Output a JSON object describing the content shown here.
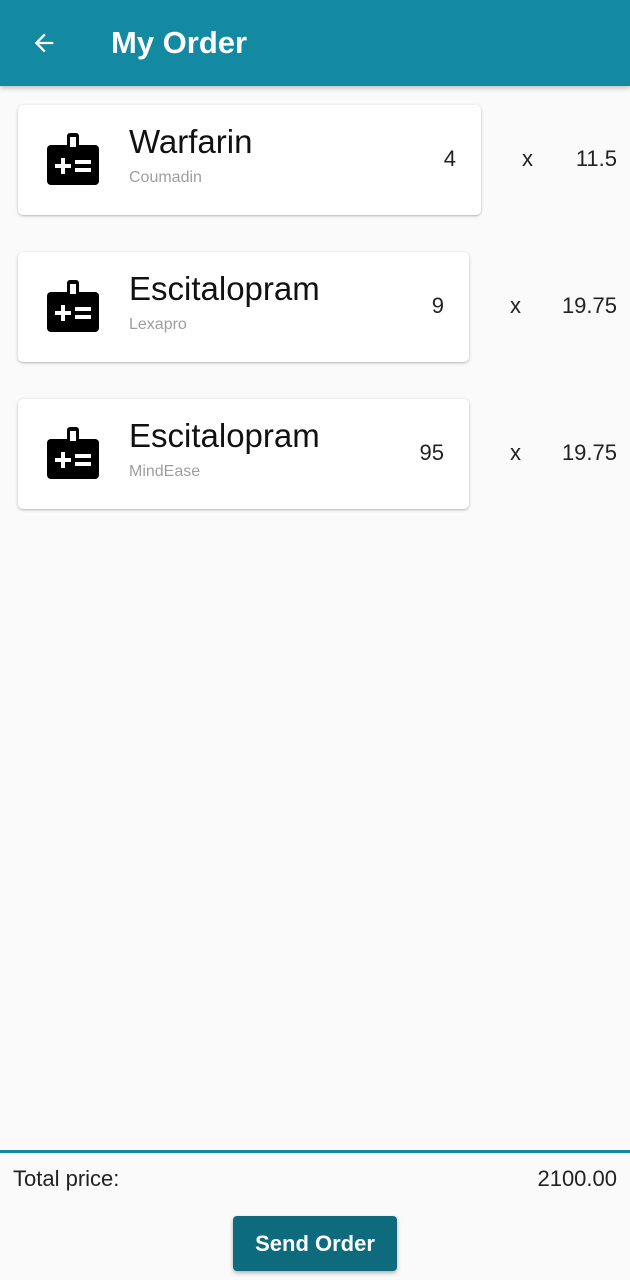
{
  "app_bar": {
    "title": "My Order",
    "back_icon": "arrow-back-icon",
    "color": "#138aa1"
  },
  "order": {
    "items": [
      {
        "name": "Warfarin",
        "brand": "Coumadin",
        "quantity": "4",
        "times": "x",
        "price": "11.5",
        "icon": "medical-kit-icon"
      },
      {
        "name": "Escitalopram",
        "brand": "Lexapro",
        "quantity": "9",
        "times": "x",
        "price": "19.75",
        "icon": "medical-kit-icon"
      },
      {
        "name": "Escitalopram",
        "brand": "MindEase",
        "quantity": "95",
        "times": "x",
        "price": "19.75",
        "icon": "medical-kit-icon"
      }
    ]
  },
  "footer": {
    "total_label": "Total price:",
    "total_value": "2100.00",
    "send_label": "Send Order",
    "button_color": "#0e6b7e"
  }
}
